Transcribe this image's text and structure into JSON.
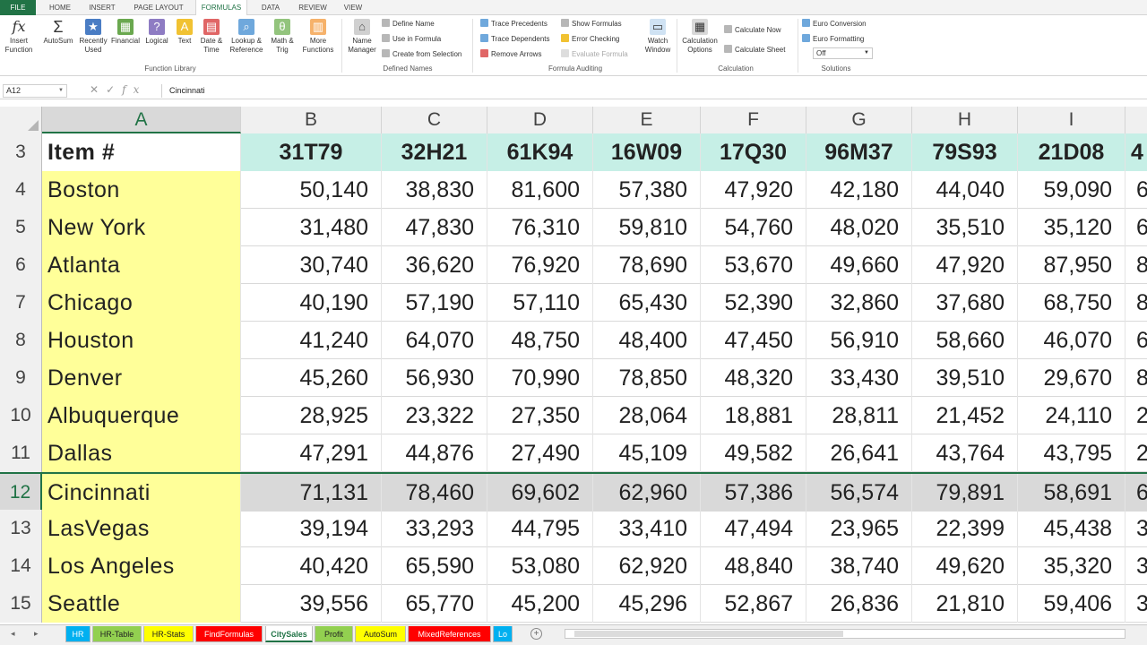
{
  "ribbon_tabs": [
    "FILE",
    "HOME",
    "INSERT",
    "PAGE LAYOUT",
    "FORMULAS",
    "DATA",
    "REVIEW",
    "VIEW"
  ],
  "function_library": {
    "insert_function": "Insert Function",
    "autosum": "AutoSum",
    "recently_used": "Recently Used",
    "financial": "Financial",
    "logical": "Logical",
    "text": "Text",
    "date_time": "Date & Time",
    "lookup_reference": "Lookup & Reference",
    "math_trig": "Math & Trig",
    "more_functions": "More Functions",
    "group_label": "Function Library"
  },
  "defined_names": {
    "name_manager": "Name Manager",
    "define_name": "Define Name",
    "use_in_formula": "Use in Formula",
    "create_from_selection": "Create from Selection",
    "group_label": "Defined Names"
  },
  "formula_auditing": {
    "trace_precedents": "Trace Precedents",
    "trace_dependents": "Trace Dependents",
    "remove_arrows": "Remove Arrows",
    "show_formulas": "Show Formulas",
    "error_checking": "Error Checking",
    "evaluate_formula": "Evaluate Formula",
    "watch_window": "Watch Window",
    "group_label": "Formula Auditing"
  },
  "calculation": {
    "calculation_options": "Calculation Options",
    "calculate_now": "Calculate Now",
    "calculate_sheet": "Calculate Sheet",
    "group_label": "Calculation"
  },
  "solutions": {
    "euro_conversion": "Euro Conversion",
    "euro_formatting": "Euro Formatting",
    "dropdown_value": "Off",
    "group_label": "Solutions"
  },
  "formula_bar": {
    "name_box": "A12",
    "content": "Cincinnati"
  },
  "columns": [
    "A",
    "B",
    "C",
    "D",
    "E",
    "F",
    "G",
    "H",
    "I"
  ],
  "header_row": {
    "row_number": "3",
    "label": "Item #",
    "codes": [
      "31T79",
      "32H21",
      "61K94",
      "16W09",
      "17Q30",
      "96M37",
      "79S93",
      "21D08"
    ],
    "partial": "4"
  },
  "rows": [
    {
      "num": "4",
      "city": "Boston",
      "values": [
        "50,140",
        "38,830",
        "81,600",
        "57,380",
        "47,920",
        "42,180",
        "44,040",
        "59,090"
      ],
      "partial": "6"
    },
    {
      "num": "5",
      "city": "New York",
      "values": [
        "31,480",
        "47,830",
        "76,310",
        "59,810",
        "54,760",
        "48,020",
        "35,510",
        "35,120"
      ],
      "partial": "6"
    },
    {
      "num": "6",
      "city": "Atlanta",
      "values": [
        "30,740",
        "36,620",
        "76,920",
        "78,690",
        "53,670",
        "49,660",
        "47,920",
        "87,950"
      ],
      "partial": "8"
    },
    {
      "num": "7",
      "city": "Chicago",
      "values": [
        "40,190",
        "57,190",
        "57,110",
        "65,430",
        "52,390",
        "32,860",
        "37,680",
        "68,750"
      ],
      "partial": "8"
    },
    {
      "num": "8",
      "city": "Houston",
      "values": [
        "41,240",
        "64,070",
        "48,750",
        "48,400",
        "47,450",
        "56,910",
        "58,660",
        "46,070"
      ],
      "partial": "6"
    },
    {
      "num": "9",
      "city": "Denver",
      "values": [
        "45,260",
        "56,930",
        "70,990",
        "78,850",
        "48,320",
        "33,430",
        "39,510",
        "29,670"
      ],
      "partial": "8"
    },
    {
      "num": "10",
      "city": "Albuquerque",
      "values": [
        "28,925",
        "23,322",
        "27,350",
        "28,064",
        "18,881",
        "28,811",
        "21,452",
        "24,110"
      ],
      "partial": "2"
    },
    {
      "num": "11",
      "city": "Dallas",
      "values": [
        "47,291",
        "44,876",
        "27,490",
        "45,109",
        "49,582",
        "26,641",
        "43,764",
        "43,795"
      ],
      "partial": "2"
    },
    {
      "num": "12",
      "city": "Cincinnati",
      "values": [
        "71,131",
        "78,460",
        "69,602",
        "62,960",
        "57,386",
        "56,574",
        "79,891",
        "58,691"
      ],
      "partial": "6"
    },
    {
      "num": "13",
      "city": "LasVegas",
      "values": [
        "39,194",
        "33,293",
        "44,795",
        "33,410",
        "47,494",
        "23,965",
        "22,399",
        "45,438"
      ],
      "partial": "3"
    },
    {
      "num": "14",
      "city": "Los Angeles",
      "values": [
        "40,420",
        "65,590",
        "53,080",
        "62,920",
        "48,840",
        "38,740",
        "49,620",
        "35,320"
      ],
      "partial": "3"
    },
    {
      "num": "15",
      "city": "Seattle",
      "values": [
        "39,556",
        "65,770",
        "45,200",
        "45,296",
        "52,867",
        "26,836",
        "21,810",
        "59,406"
      ],
      "partial": "3"
    }
  ],
  "sheet_tabs": [
    {
      "label": "HR",
      "color": "#00b0f0"
    },
    {
      "label": "HR-Table",
      "color": "#92d050"
    },
    {
      "label": "HR-Stats",
      "color": "#ffff00"
    },
    {
      "label": "FindFormulas",
      "color": "#ff0000"
    },
    {
      "label": "CitySales",
      "color": "#ffffff"
    },
    {
      "label": "Profit",
      "color": "#92d050"
    },
    {
      "label": "AutoSum",
      "color": "#ffff00"
    },
    {
      "label": "MixedReferences",
      "color": "#ff0000"
    },
    {
      "label": "Lo",
      "color": "#00b0f0"
    }
  ],
  "colors": {
    "excel_green": "#217346",
    "city_fill": "#ffff99",
    "header_fill": "#c6efe6",
    "selected_fill": "#d9d9d9"
  }
}
